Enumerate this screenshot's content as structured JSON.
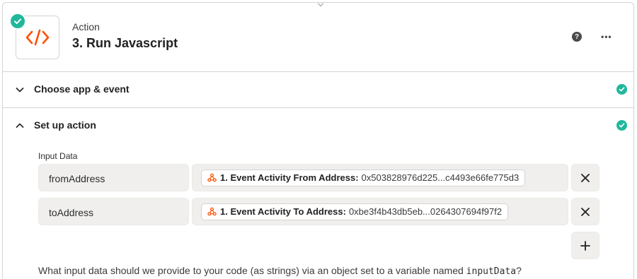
{
  "header": {
    "kind": "Action",
    "title": "3. Run Javascript",
    "help_glyph": "?",
    "more_glyph": "•••",
    "icon": "code-icon",
    "accent": "#ff4f00",
    "status_color": "#1fb89a"
  },
  "sections": {
    "choose_app": {
      "title": "Choose app & event",
      "expanded": false,
      "complete": true
    },
    "setup_action": {
      "title": "Set up action",
      "expanded": true,
      "complete": true
    }
  },
  "input_data": {
    "label": "Input Data",
    "rows": [
      {
        "key": "fromAddress",
        "pill_label": "1. Event Activity From Address:",
        "pill_value": "0x503828976d225...c4493e66fe775d3"
      },
      {
        "key": "toAddress",
        "pill_label": "1. Event Activity To Address:",
        "pill_value": "0xbe3f4b43db5eb...0264307694f97f2"
      }
    ],
    "remove_glyph": "✕",
    "add_glyph": "+"
  },
  "help": {
    "prefix": "What input data should we provide to your code (as strings) via an object set to a variable named ",
    "code": "inputData",
    "suffix": "?"
  }
}
